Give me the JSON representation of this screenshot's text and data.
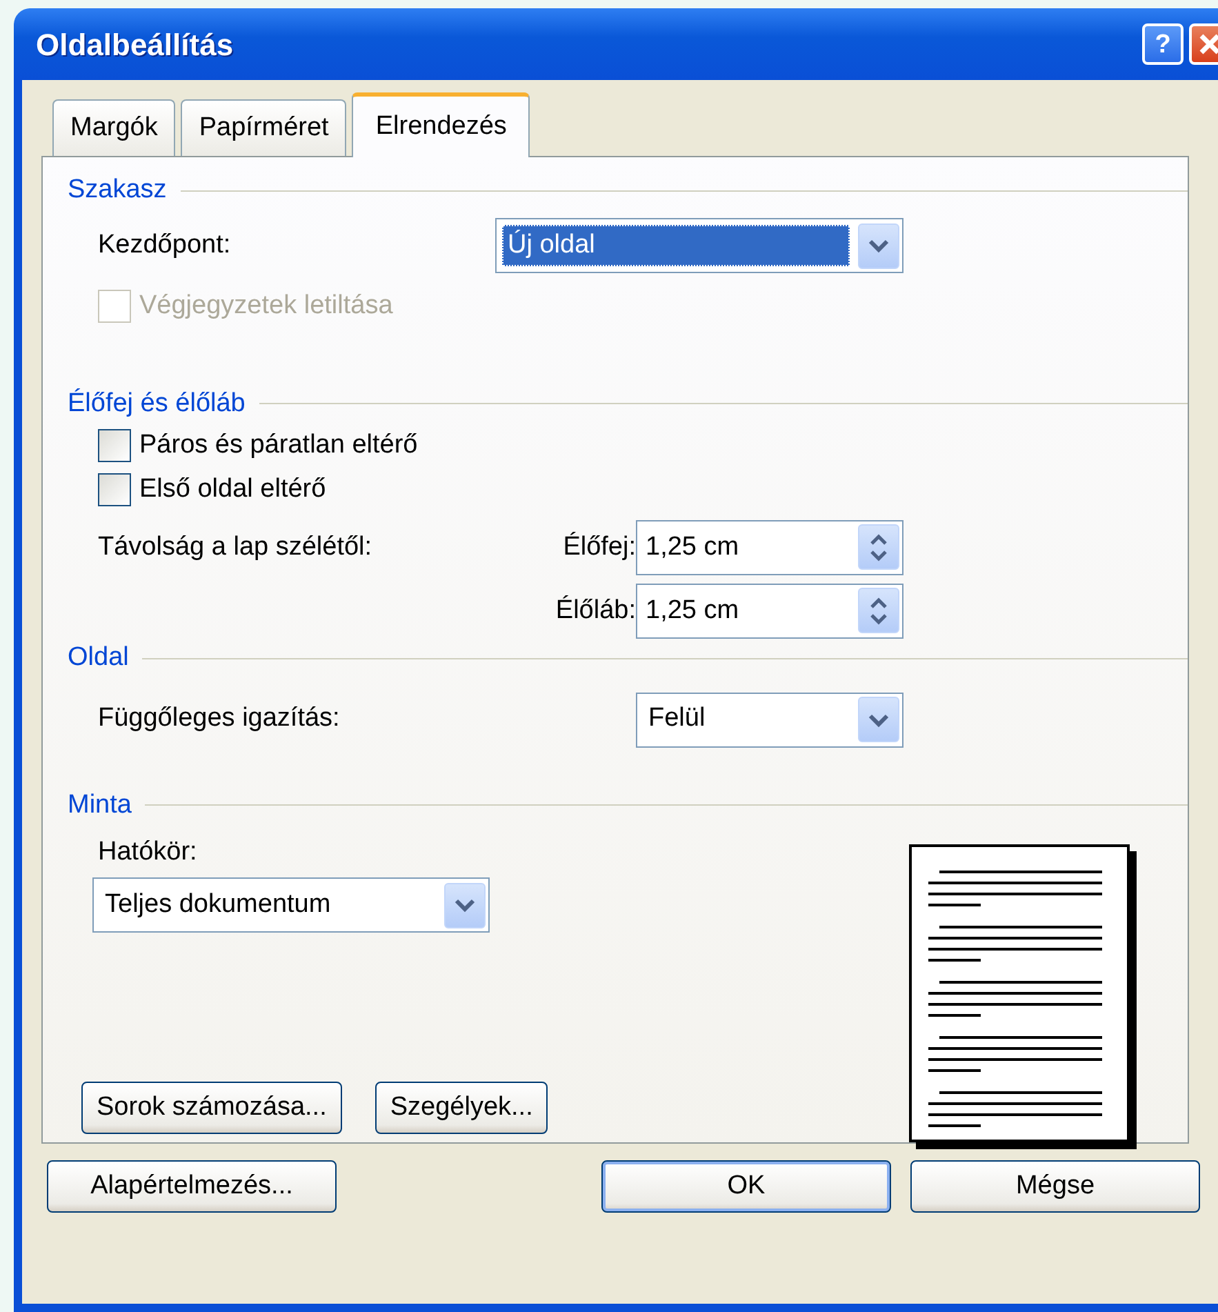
{
  "window": {
    "title": "Oldalbeállítás",
    "help": "?"
  },
  "tabs": [
    {
      "label": "Margók",
      "selected": false
    },
    {
      "label": "Papírméret",
      "selected": false
    },
    {
      "label": "Elrendezés",
      "selected": true
    }
  ],
  "sections": [
    {
      "title": "Szakasz",
      "rows": [
        {
          "kind": "dropdown",
          "label": "Kezdőpont:",
          "value": "Új oldal",
          "focused": true
        },
        {
          "kind": "checkbox",
          "label": "Végjegyzetek letiltása",
          "checked": false,
          "disabled": true
        }
      ]
    },
    {
      "title": "Élőfej és élőláb",
      "rows": [
        {
          "kind": "checkbox",
          "label": "Páros és páratlan eltérő",
          "checked": false,
          "disabled": false
        },
        {
          "kind": "checkbox",
          "label": "Első oldal eltérő",
          "checked": false,
          "disabled": false
        },
        {
          "kind": "spin",
          "label": "Távolság a lap szélétől:",
          "sublabel": "Élőfej:",
          "value": "1,25 cm"
        },
        {
          "kind": "spin",
          "sublabel": "Élőláb:",
          "value": "1,25 cm"
        }
      ]
    },
    {
      "title": "Oldal",
      "rows": [
        {
          "kind": "dropdown",
          "label": "Függőleges igazítás:",
          "value": "Felül",
          "focused": false
        }
      ]
    },
    {
      "title": "Minta",
      "rows": [
        {
          "kind": "stacked_dropdown",
          "label": "Hatókör:",
          "value": "Teljes dokumentum"
        },
        {
          "kind": "buttons",
          "buttons": [
            "Sorok számozása...",
            "Szegélyek..."
          ]
        }
      ]
    }
  ],
  "footer_buttons": [
    {
      "label": "Alapértelmezés...",
      "default": false
    },
    {
      "label": "OK",
      "default": true
    },
    {
      "label": "Mégse",
      "default": false
    }
  ]
}
